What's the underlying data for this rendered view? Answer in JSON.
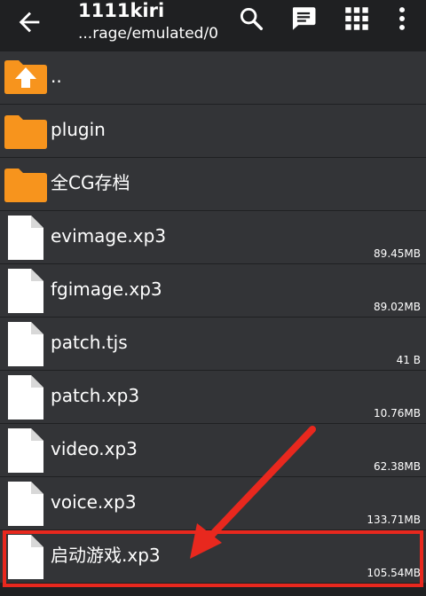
{
  "toolbar": {
    "title": "1111kiri",
    "path": "...rage/emulated/0",
    "icons": [
      "back-arrow-icon",
      "search-icon",
      "message-icon",
      "grid-icon",
      "more-vert-icon"
    ]
  },
  "files": [
    {
      "name": "..",
      "size": "",
      "type": "parent-folder"
    },
    {
      "name": "plugin",
      "size": "",
      "type": "folder"
    },
    {
      "name": "全CG存档",
      "size": "",
      "type": "folder"
    },
    {
      "name": "evimage.xp3",
      "size": "89.45MB",
      "type": "file"
    },
    {
      "name": "fgimage.xp3",
      "size": "89.02MB",
      "type": "file"
    },
    {
      "name": "patch.tjs",
      "size": "41 B",
      "type": "file"
    },
    {
      "name": "patch.xp3",
      "size": "10.76MB",
      "type": "file"
    },
    {
      "name": "video.xp3",
      "size": "62.38MB",
      "type": "file"
    },
    {
      "name": "voice.xp3",
      "size": "133.71MB",
      "type": "file"
    },
    {
      "name": "启动游戏.xp3",
      "size": "105.54MB",
      "type": "file"
    }
  ],
  "colors": {
    "background": "#1f2022",
    "row": "#333437",
    "folder": "#f7941d",
    "annotation": "#e8281e"
  }
}
